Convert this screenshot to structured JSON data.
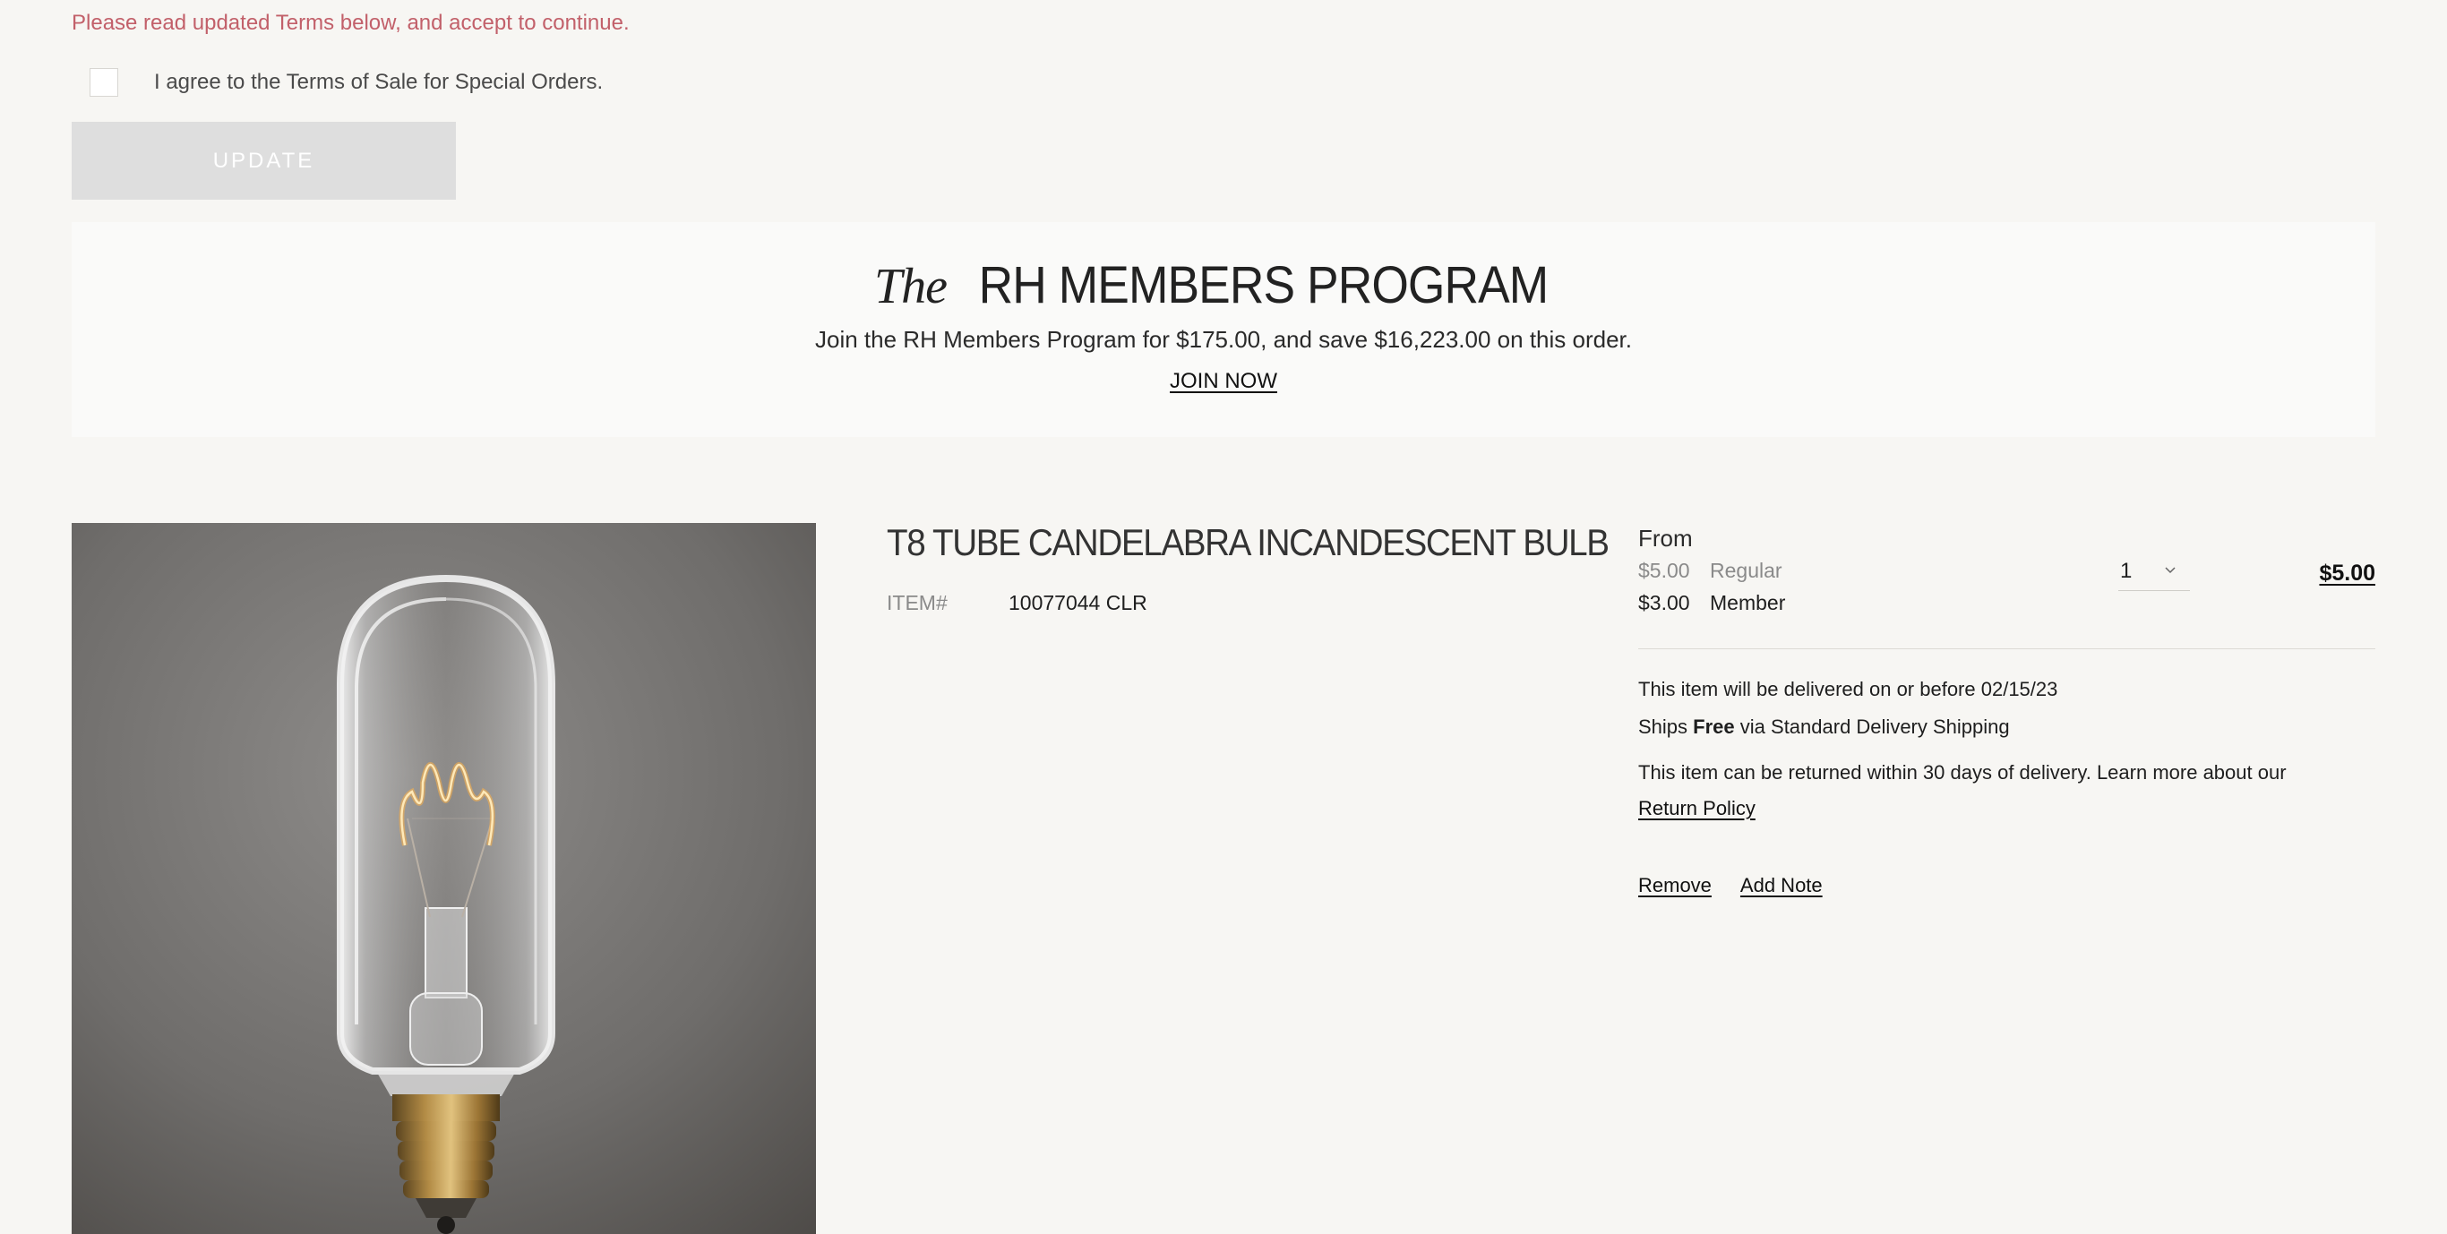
{
  "terms": {
    "warning": "Please read updated Terms below, and accept to continue.",
    "agree_label": "I agree to the Terms of Sale for Special Orders.",
    "update_label": "UPDATE"
  },
  "members_program": {
    "title_prefix": "The",
    "title": "RH MEMBERS PROGRAM",
    "description": "Join the RH Members Program for $175.00, and save $16,223.00 on this order.",
    "join_label": "JOIN NOW"
  },
  "product": {
    "image_icon": "light-bulb-photo",
    "title": "T8 TUBE CANDELABRA INCANDESCENT BULB",
    "item_label": "ITEM#",
    "item_number": "10077044 CLR",
    "from_label": "From",
    "regular_price": "$5.00",
    "regular_label": "Regular",
    "member_price": "$3.00",
    "member_label": "Member",
    "quantity": "1",
    "line_total": "$5.00",
    "delivery_text": "This item will be delivered on or before 02/15/23",
    "ships_prefix": "Ships",
    "ships_bold": "Free",
    "ships_suffix": "via Standard Delivery Shipping",
    "returns_text": "This item can be returned within 30 days of delivery. Learn more about our",
    "return_policy_label": "Return Policy",
    "remove_label": "Remove",
    "add_note_label": "Add Note"
  },
  "colors": {
    "background": "#f7f6f3",
    "warning": "#c2606a",
    "button_disabled": "#dedede",
    "banner": "#fafaf9"
  }
}
